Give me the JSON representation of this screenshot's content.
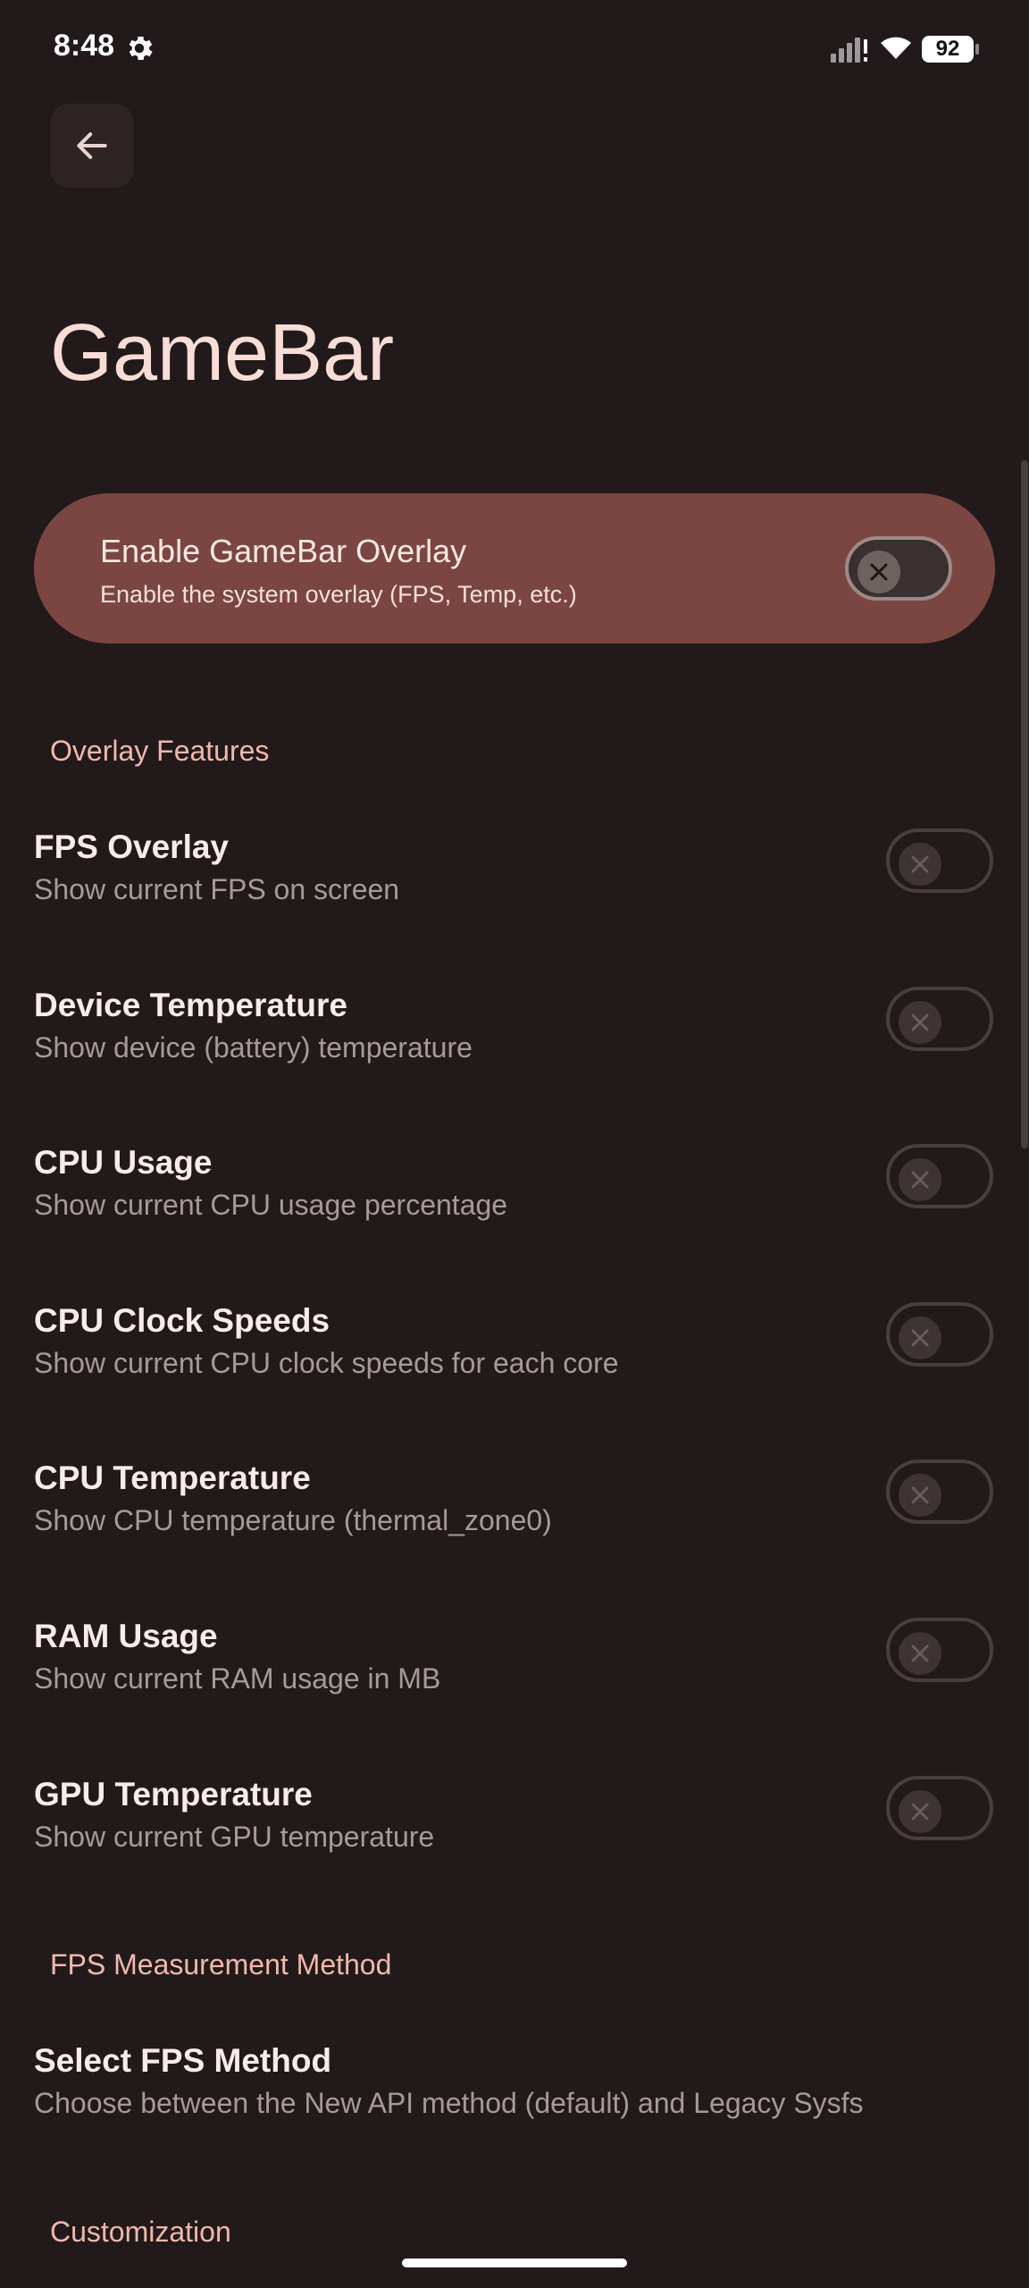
{
  "status_bar": {
    "time": "8:48",
    "battery": "92"
  },
  "page": {
    "title": "GameBar"
  },
  "master": {
    "title": "Enable GameBar Overlay",
    "subtitle": "Enable the system overlay (FPS, Temp, etc.)",
    "enabled": false
  },
  "sections": {
    "overlay_features": "Overlay Features",
    "fps_method": "FPS Measurement Method",
    "customization": "Customization"
  },
  "features": [
    {
      "title": "FPS Overlay",
      "subtitle": "Show current FPS on screen",
      "enabled": false
    },
    {
      "title": "Device Temperature",
      "subtitle": "Show device (battery) temperature",
      "enabled": false
    },
    {
      "title": "CPU Usage",
      "subtitle": "Show current CPU usage percentage",
      "enabled": false
    },
    {
      "title": "CPU Clock Speeds",
      "subtitle": "Show current CPU clock speeds for each core",
      "enabled": false
    },
    {
      "title": "CPU Temperature",
      "subtitle": "Show CPU temperature (thermal_zone0)",
      "enabled": false
    },
    {
      "title": "RAM Usage",
      "subtitle": "Show current RAM usage in MB",
      "enabled": false
    },
    {
      "title": "GPU Temperature",
      "subtitle": "Show current GPU temperature",
      "enabled": false
    }
  ],
  "fps_method": {
    "title": "Select FPS Method",
    "subtitle": "Choose between the New API method (default) and Legacy Sysfs"
  },
  "colors": {
    "background": "#221a1a",
    "card": "#7b4642",
    "accent_text": "#f0b8ad"
  }
}
